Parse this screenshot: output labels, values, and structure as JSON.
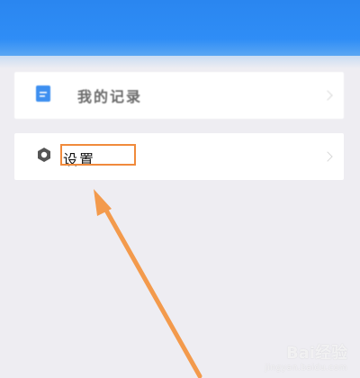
{
  "menu": {
    "records": {
      "label": "我的记录",
      "icon": "document-icon",
      "icon_color": "#3d8ff0"
    },
    "settings": {
      "label": "设置",
      "icon": "gear-icon",
      "icon_color": "#555555"
    }
  },
  "annotation": {
    "highlight_color": "#f08a3c",
    "arrow_color": "#f39a4c"
  },
  "watermark": {
    "brand": "Bai经验",
    "url": "jingyan.baidu.com"
  },
  "colors": {
    "header": "#2f8df6",
    "background": "#eeedf2"
  }
}
